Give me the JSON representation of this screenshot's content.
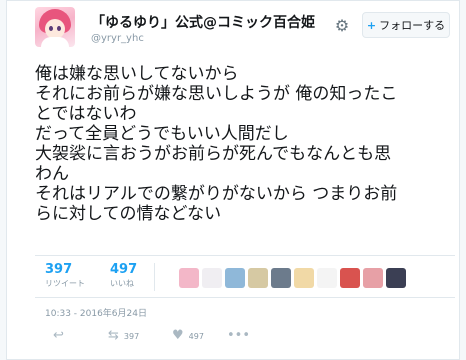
{
  "tweet": {
    "display_name": "「ゆるゆり」公式@コミック百合姫",
    "handle": "@yryr_yhc",
    "follow_label": "フォローする",
    "follow_icon": "follow-plus-icon",
    "text_lines": [
      "俺は嫌な思いしてないから",
      "それにお前らが嫌な思いしようが 俺の知ったこ",
      "とではないわ",
      "だって全員どうでもいい人間だし",
      "大袈裟に言おうがお前らが死んでもなんとも思",
      "わん",
      "それはリアルでの繋がりがないから つまりお前",
      "らに対しての情などない"
    ],
    "retweet_count": "397",
    "retweet_label": "リツイート",
    "like_count": "497",
    "like_label": "いいね",
    "timestamp": "10:33 - 2016年6月24日",
    "actions": {
      "retweet_count": "397",
      "like_count": "497"
    },
    "engager_avatar_colors": [
      "#f3b7c8",
      "#f0eef2",
      "#8fb8d9",
      "#d6c9a3",
      "#6c7b8c",
      "#f1d9a6",
      "#f4f4f4",
      "#d9534f",
      "#e7a0a6",
      "#3b3f54"
    ],
    "accent_color": "#1da1f2"
  }
}
